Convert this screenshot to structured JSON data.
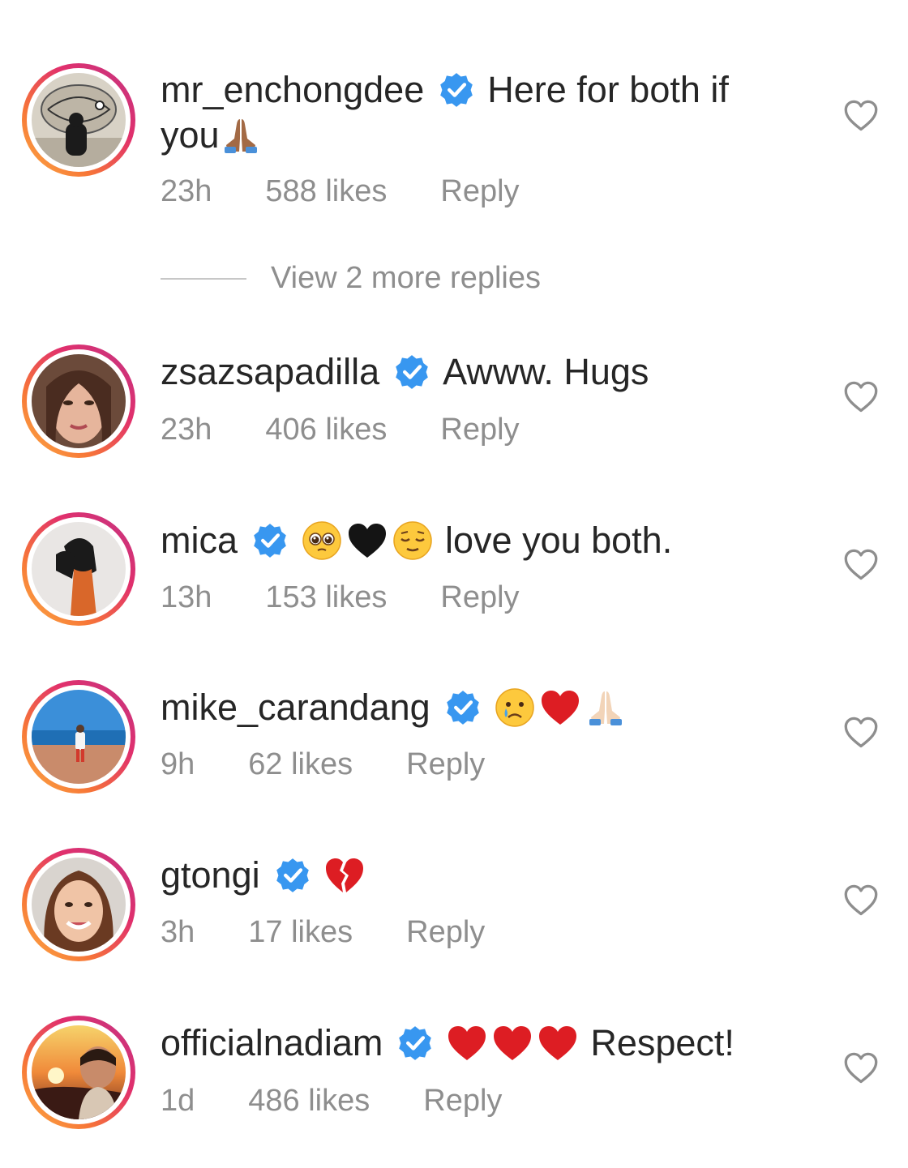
{
  "comments": [
    {
      "username": "mr_enchongdee",
      "text": "Here for both if",
      "text_continued": "you",
      "emojis_inline": [],
      "emojis_trailing": [
        "folded-hands-medium-dark"
      ],
      "time": "23h",
      "likes": "588 likes",
      "reply": "Reply"
    },
    {
      "username": "zsazsapadilla",
      "text": "Awww. Hugs",
      "emojis_inline": [],
      "time": "23h",
      "likes": "406 likes",
      "reply": "Reply"
    },
    {
      "username": "mica",
      "text": "love you both.",
      "emojis_inline": [
        "pleading-face",
        "black-heart",
        "relieved-face"
      ],
      "time": "13h",
      "likes": "153 likes",
      "reply": "Reply"
    },
    {
      "username": "mike_carandang",
      "text": "",
      "emojis_inline": [
        "crying-face",
        "red-heart",
        "folded-hands-light"
      ],
      "time": "9h",
      "likes": "62 likes",
      "reply": "Reply"
    },
    {
      "username": "gtongi",
      "text": "",
      "emojis_inline": [
        "broken-heart"
      ],
      "time": "3h",
      "likes": "17 likes",
      "reply": "Reply"
    },
    {
      "username": "officialnadiam",
      "text": "Respect!",
      "emojis_inline": [
        "red-heart",
        "red-heart",
        "red-heart"
      ],
      "time": "1d",
      "likes": "486 likes",
      "reply": "Reply"
    }
  ],
  "view_more_replies": "View 2 more replies",
  "colors": {
    "username": "#262626",
    "meta": "#8e8e8e",
    "verified": "#3897f0",
    "ring_start": "#fcaf45",
    "ring_end": "#c13584"
  }
}
